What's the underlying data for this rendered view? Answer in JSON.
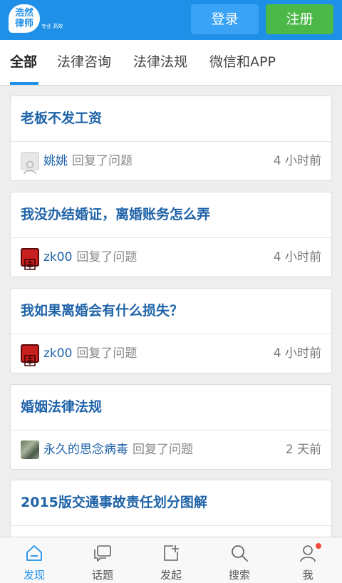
{
  "header": {
    "logo_text_line1": "浩然",
    "logo_text_line2": "律师",
    "logo_subtext": "专业 高效",
    "login_label": "登录",
    "register_label": "注册"
  },
  "tabs": [
    {
      "label": "全部",
      "active": true
    },
    {
      "label": "法律咨询",
      "active": false
    },
    {
      "label": "法律法规",
      "active": false
    },
    {
      "label": "微信和APP",
      "active": false
    }
  ],
  "feed": [
    {
      "title": "老板不发工资",
      "user": "姚姚",
      "action": "回复了问题",
      "time": "4 小时前",
      "avatar": "gray"
    },
    {
      "title": "我没办结婚证，离婚账务怎么弄",
      "user": "zk00",
      "action": "回复了问题",
      "time": "4 小时前",
      "avatar": "red"
    },
    {
      "title": "我如果离婚会有什么损失？",
      "user": "zk00",
      "action": "回复了问题",
      "time": "4 小时前",
      "avatar": "red"
    },
    {
      "title": "婚姻法律法规",
      "user": "永久的思念病毒",
      "action": "回复了问题",
      "time": "2 天前",
      "avatar": "photo"
    },
    {
      "title": "2015版交通事故责任划分图解",
      "user": "",
      "action": "",
      "time": "",
      "avatar": ""
    }
  ],
  "bottom_nav": [
    {
      "label": "发现",
      "icon": "home-icon",
      "active": true
    },
    {
      "label": "话题",
      "icon": "chat-icon",
      "active": false
    },
    {
      "label": "发起",
      "icon": "compose-icon",
      "active": false
    },
    {
      "label": "搜索",
      "icon": "search-icon",
      "active": false
    },
    {
      "label": "我",
      "icon": "user-icon",
      "active": false,
      "has_notification": true
    }
  ],
  "colors": {
    "accent": "#1e90e8",
    "register": "#4cb848",
    "title_link": "#1f63a8",
    "notification": "#f04b3a"
  }
}
